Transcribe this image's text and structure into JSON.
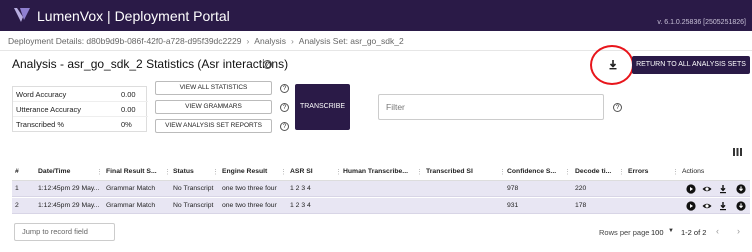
{
  "header": {
    "brand": "LumenVox | Deployment Portal",
    "version": "v. 6.1.0.25836 [2505251826]"
  },
  "breadcrumb": [
    "Deployment Details: d80b9d9b-086f-42f0-a728-d95f39dc2229",
    "Analysis",
    "Analysis Set: asr_go_sdk_2"
  ],
  "page": {
    "title": "Analysis - asr_go_sdk_2 Statistics (Asr interactions)",
    "return_label": "RETURN TO ALL ANALYSIS SETS",
    "help_glyph": "?"
  },
  "stats": [
    {
      "label": "Word Accuracy",
      "value": "0.00"
    },
    {
      "label": "Utterance Accuracy",
      "value": "0.00"
    },
    {
      "label": "Transcribed %",
      "value": "0%"
    }
  ],
  "buttons": {
    "view_all": "VIEW ALL STATISTICS",
    "view_grammars": "VIEW GRAMMARS",
    "view_reports": "VIEW ANALYSIS SET REPORTS",
    "transcribe": "TRANSCRIBE"
  },
  "filter": {
    "placeholder": "Filter"
  },
  "table": {
    "columns": [
      "#",
      "Date/Time",
      "Final Result S...",
      "Status",
      "Engine Result",
      "ASR SI",
      "Human Transcribe...",
      "Transcribed SI",
      "Confidence S...",
      "Decode ti...",
      "Errors",
      "Actions"
    ],
    "rows": [
      {
        "num": "1",
        "datetime": "1:12:45pm 29 May...",
        "final_result": "Grammar Match",
        "status": "No Transcript",
        "engine_result": "one two three four",
        "asr_si": "1 2 3 4",
        "human": "",
        "transcribed_si": "",
        "confidence": "978",
        "decode": "220",
        "errors": ""
      },
      {
        "num": "2",
        "datetime": "1:12:45pm 29 May...",
        "final_result": "Grammar Match",
        "status": "No Transcript",
        "engine_result": "one two three four",
        "asr_si": "1 2 3 4",
        "human": "",
        "transcribed_si": "",
        "confidence": "931",
        "decode": "178",
        "errors": ""
      }
    ]
  },
  "footer": {
    "jump_placeholder": "Jump to record field",
    "rows_per_page_label": "Rows per page",
    "rows_per_page_value": "100",
    "pagination": "1-2 of 2"
  },
  "colors": {
    "brand": "#2a1a47",
    "row_bg": "#e8e6f3",
    "highlight": "#e8151b"
  }
}
